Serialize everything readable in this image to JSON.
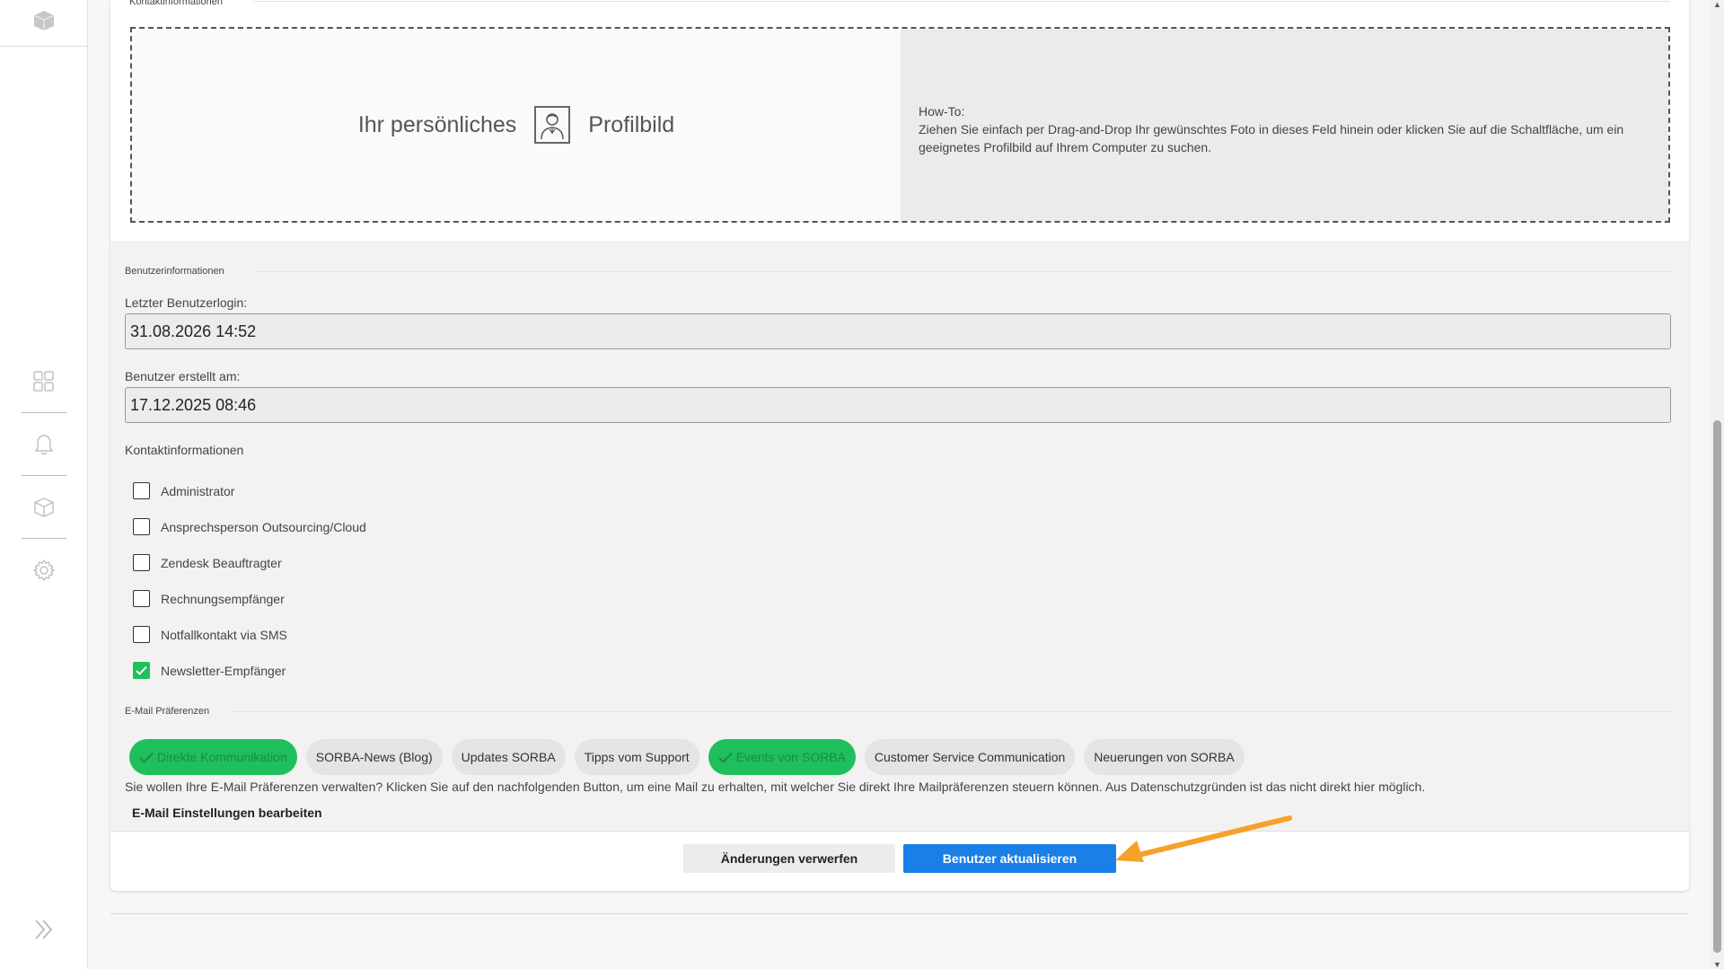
{
  "sections": {
    "contact_info_top_legend": "Kontaktinformationen",
    "user_info_legend": "Benutzerinformationen",
    "contact_info_title": "Kontaktinformationen",
    "email_prefs_legend": "E-Mail Präferenzen"
  },
  "dropzone": {
    "text_left": "Ihr persönliches",
    "text_right": "Profilbild",
    "howto_title": "How-To:",
    "howto_text": "Ziehen Sie einfach per Drag-and-Drop Ihr gewünschtes Foto in dieses Feld hinein oder klicken Sie auf die Schaltfläche, um ein geeignetes Profilbild auf Ihrem Computer zu suchen."
  },
  "fields": {
    "last_login_label": "Letzter Benutzerlogin:",
    "last_login_value": "31.08.2026 14:52",
    "created_label": "Benutzer erstellt am:",
    "created_value": "17.12.2025 08:46"
  },
  "checkboxes": [
    {
      "label": "Administrator",
      "checked": false
    },
    {
      "label": "Ansprechsperson Outsourcing/Cloud",
      "checked": false
    },
    {
      "label": "Zendesk Beauftragter",
      "checked": false
    },
    {
      "label": "Rechnungsempfänger",
      "checked": false
    },
    {
      "label": "Notfallkontakt via SMS",
      "checked": false
    },
    {
      "label": "Newsletter-Empfänger",
      "checked": true
    }
  ],
  "chips": [
    {
      "label": "Direkte Kommunikation",
      "active": true
    },
    {
      "label": "SORBA-News (Blog)",
      "active": false
    },
    {
      "label": "Updates SORBA",
      "active": false
    },
    {
      "label": "Tipps vom Support",
      "active": false
    },
    {
      "label": "Events von SORBA",
      "active": true
    },
    {
      "label": "Customer Service Communication",
      "active": false
    },
    {
      "label": "Neuerungen von SORBA",
      "active": false
    }
  ],
  "prefs": {
    "info_text": "Sie wollen Ihre E-Mail Präferenzen verwalten? Klicken Sie auf den nachfolgenden Button, um eine Mail zu erhalten, mit welcher Sie direkt Ihre Mailpräferenzen steuern können. Aus Datenschutzgründen ist das nicht direkt hier möglich.",
    "edit_link": "E-Mail Einstellungen bearbeiten"
  },
  "buttons": {
    "discard": "Änderungen verwerfen",
    "update": "Benutzer aktualisieren"
  },
  "colors": {
    "accent_blue": "#1a7fe6",
    "active_green": "#1fbf5b",
    "annotation_arrow": "#f5a12a"
  },
  "icons": {
    "sidebar": [
      "box-icon",
      "dashboard-grid-icon",
      "bell-icon",
      "box-icon",
      "gear-icon",
      "expand-chevrons-icon"
    ],
    "dropzone": "user-avatar-icon"
  }
}
